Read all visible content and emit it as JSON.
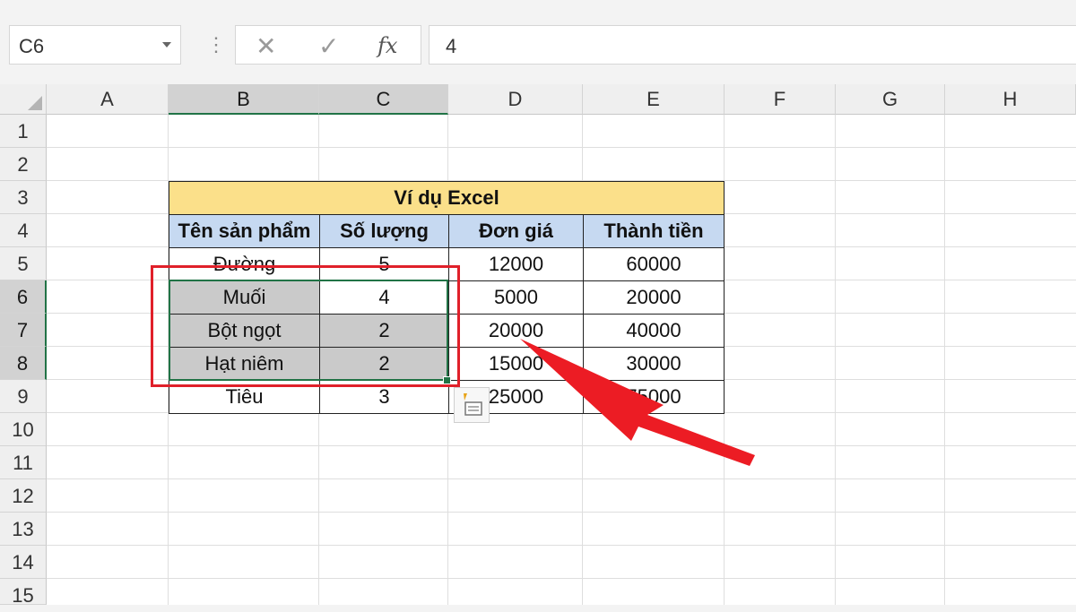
{
  "formula_bar": {
    "name_box": "C6",
    "cancel_icon": "✕",
    "enter_icon": "✓",
    "fx_label": "fx",
    "formula_value": "4"
  },
  "columns": [
    "A",
    "B",
    "C",
    "D",
    "E",
    "F",
    "G",
    "H"
  ],
  "rows": [
    "1",
    "2",
    "3",
    "4",
    "5",
    "6",
    "7",
    "8",
    "9",
    "10",
    "11",
    "12",
    "13",
    "14",
    "15"
  ],
  "table": {
    "title": "Ví dụ Excel",
    "headers": [
      "Tên sản phẩm",
      "Số lượng",
      "Đơn giá",
      "Thành tiền"
    ],
    "data": [
      [
        "Đường",
        "5",
        "12000",
        "60000"
      ],
      [
        "Muối",
        "4",
        "5000",
        "20000"
      ],
      [
        "Bột ngọt",
        "2",
        "20000",
        "40000"
      ],
      [
        "Hạt niêm",
        "2",
        "15000",
        "30000"
      ],
      [
        "Tiêu",
        "3",
        "25000",
        "75000"
      ]
    ]
  },
  "colors": {
    "title_fill": "#fbe08a",
    "header_fill": "#c6d9f1",
    "selection": "#217346",
    "annotation": "#e0202a"
  }
}
